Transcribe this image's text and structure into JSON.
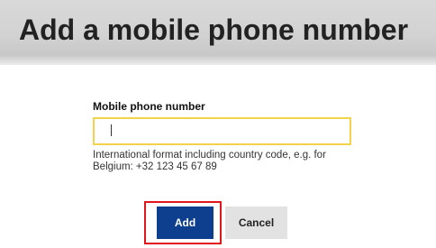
{
  "header": {
    "title": "Add a mobile phone number"
  },
  "form": {
    "phone_label": "Mobile phone number",
    "phone_value": "",
    "help_text": "International format including country code, e.g. for Belgium: +32 123 45 67 89"
  },
  "actions": {
    "add_label": "Add",
    "cancel_label": "Cancel"
  },
  "colors": {
    "primary_button": "#0e3f8f",
    "input_focus_border": "#f2d34b",
    "highlight_outline": "#e0161c"
  }
}
